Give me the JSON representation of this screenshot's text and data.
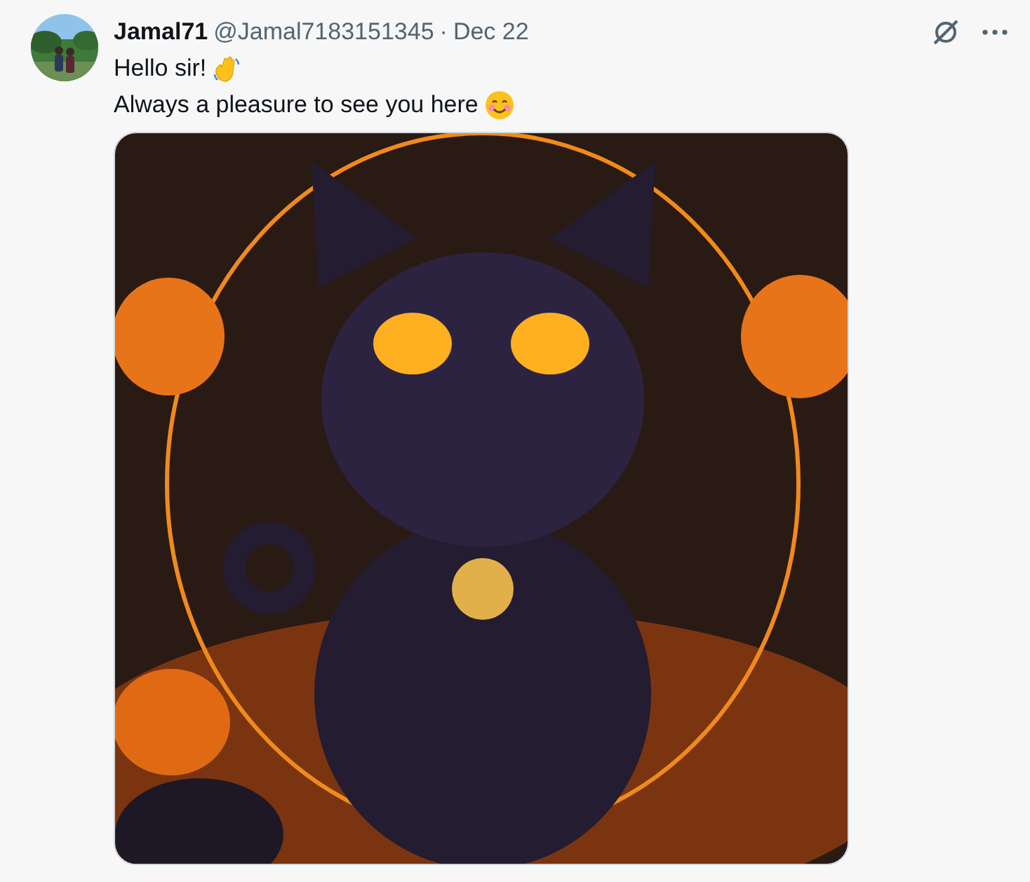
{
  "post": {
    "author": {
      "name": "Jamal71",
      "handle": "@Jamal7183151345"
    },
    "separator": "·",
    "date": "Dec 22",
    "lines": [
      {
        "text": "Hello sir!",
        "kind": "wave"
      },
      {
        "text": "Always a pleasure to see you here",
        "kind": "smile"
      }
    ]
  }
}
